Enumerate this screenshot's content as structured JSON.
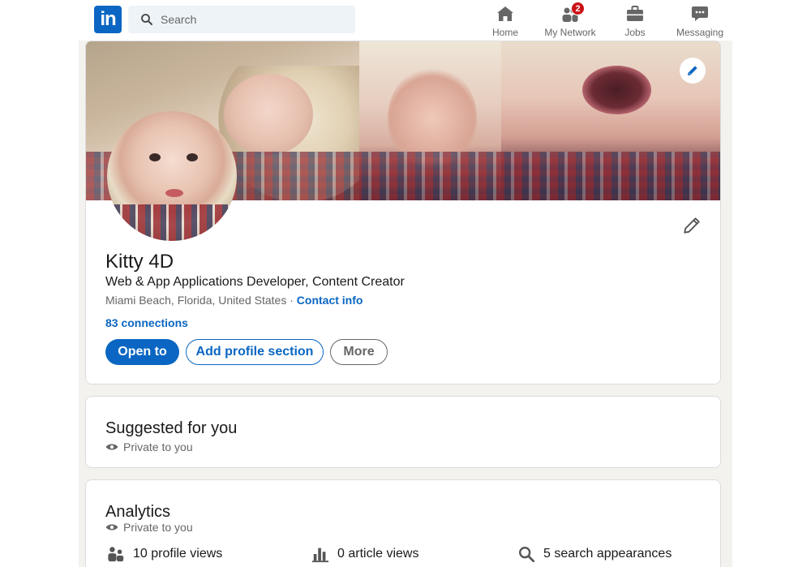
{
  "nav": {
    "logo_text": "in",
    "search_placeholder": "Search",
    "items": [
      {
        "label": "Home",
        "icon": "home-icon"
      },
      {
        "label": "My Network",
        "icon": "network-icon",
        "badge": "2"
      },
      {
        "label": "Jobs",
        "icon": "briefcase-icon"
      },
      {
        "label": "Messaging",
        "icon": "chat-icon"
      }
    ]
  },
  "profile": {
    "name": "Kitty 4D",
    "headline": "Web & App Applications Developer, Content Creator",
    "location": "Miami Beach, Florida, United States",
    "separator": " · ",
    "contact_info": "Contact info",
    "connections": "83 connections",
    "buttons": {
      "open_to": "Open to",
      "add_section": "Add profile section",
      "more": "More"
    }
  },
  "suggested": {
    "title": "Suggested for you",
    "privacy": "Private to you"
  },
  "analytics": {
    "title": "Analytics",
    "privacy": "Private to you",
    "metrics": [
      {
        "label": "10 profile views",
        "icon": "people-icon"
      },
      {
        "label": "0 article views",
        "icon": "bar-chart-icon"
      },
      {
        "label": "5 search appearances",
        "icon": "search-icon"
      }
    ]
  },
  "colors": {
    "brand": "#0a66c2",
    "badge": "#cc1016",
    "page_bg": "#f3f2ef"
  }
}
